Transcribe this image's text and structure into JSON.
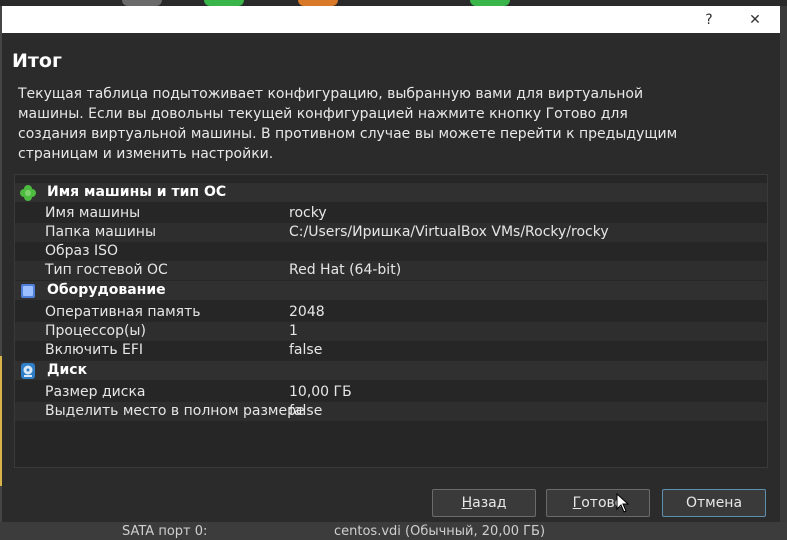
{
  "background": {
    "bottom_left": "SATA порт 0:",
    "bottom_right": "centos.vdi (Обычный, 20,00 ГБ)"
  },
  "dialog": {
    "title_help": "?",
    "title_close": "✕",
    "heading": "Итог",
    "description": "Текущая таблица подытоживает конфигурацию, выбранную вами для виртуальной машины. Если вы довольны текущей конфигурацией нажмите кнопку Готово для создания виртуальной машины. В противном случае вы можете перейти к предыдущим страницам и изменить настройки."
  },
  "summary": {
    "groups": [
      {
        "title": "Имя машины и тип ОС",
        "icon": "clover-icon",
        "rows": [
          {
            "label": "Имя машины",
            "value": "rocky"
          },
          {
            "label": "Папка машины",
            "value": "C:/Users/Иришка/VirtualBox VMs/Rocky/rocky"
          },
          {
            "label": "Образ ISO",
            "value": ""
          },
          {
            "label": "Тип гостевой ОС",
            "value": "Red Hat (64-bit)"
          }
        ]
      },
      {
        "title": "Оборудование",
        "icon": "chip-icon",
        "rows": [
          {
            "label": "Оперативная память",
            "value": "2048"
          },
          {
            "label": "Процессор(ы)",
            "value": "1"
          },
          {
            "label": "Включить EFI",
            "value": "false"
          }
        ]
      },
      {
        "title": "Диск",
        "icon": "disk-icon",
        "rows": [
          {
            "label": "Размер диска",
            "value": "10,00 ГБ"
          },
          {
            "label": "Выделить место в полном размере",
            "value": "false"
          }
        ]
      }
    ]
  },
  "buttons": {
    "back_mnemonic": "Н",
    "back_rest": "азад",
    "finish_mnemonic": "Г",
    "finish_rest": "отово",
    "cancel": "Отмена"
  },
  "colors": {
    "dialog_bg": "#2b2b2b",
    "accent": "#5d8fb0"
  }
}
